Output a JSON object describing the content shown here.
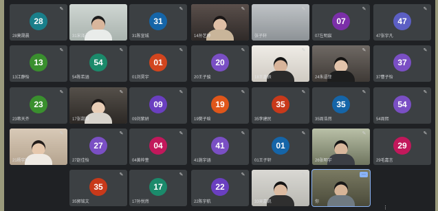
{
  "participants": [
    {
      "kind": "avatar",
      "number": "28",
      "color": "#1a7f8a",
      "name": "28莫晟晨"
    },
    {
      "kind": "video",
      "name": "31宋泽灵",
      "scene": "boy-light"
    },
    {
      "kind": "avatar",
      "number": "31",
      "color": "#1565a8",
      "name": "31陈宣城"
    },
    {
      "kind": "video",
      "name": "14孙艺婷",
      "scene": "girl-room"
    },
    {
      "kind": "video",
      "name": "张子轩",
      "scene": "empty-light"
    },
    {
      "kind": "avatar",
      "number": "07",
      "color": "#7b2fa8",
      "name": "07左明宸"
    },
    {
      "kind": "avatar",
      "number": "47",
      "color": "#5c5fc4",
      "name": "47张宇凡"
    },
    {
      "kind": "avatar",
      "number": "",
      "color": "#3c4043",
      "name": ""
    },
    {
      "kind": "avatar",
      "number": "",
      "color": "#3c4043",
      "name": ""
    },
    {
      "kind": "avatar",
      "number": "",
      "color": "#3c4043",
      "name": ""
    },
    {
      "kind": "avatar",
      "number": "",
      "color": "#3c4043",
      "name": ""
    },
    {
      "kind": "avatar",
      "number": "",
      "color": "#3c4043",
      "name": ""
    },
    {
      "kind": "avatar",
      "number": "",
      "color": "#3c4043",
      "name": ""
    },
    {
      "kind": "avatar",
      "number": "",
      "color": "#3c4043",
      "name": ""
    },
    {
      "kind": "avatar",
      "number": "13",
      "color": "#3a8f2e",
      "name": "13江静怡"
    },
    {
      "kind": "avatar",
      "number": "54",
      "color": "#1b8a6b",
      "name": "54陈若涵"
    },
    {
      "kind": "avatar",
      "number": "01",
      "color": "#d2451e",
      "name": "01刘昊宇"
    },
    {
      "kind": "avatar",
      "number": "20",
      "color": "#7a4fc4",
      "name": "20王子骏"
    },
    {
      "kind": "video",
      "name": "18王鑫辰",
      "scene": "boy-headset"
    },
    {
      "kind": "video",
      "name": "24朱语菲",
      "scene": "girl-dark"
    },
    {
      "kind": "avatar",
      "number": "37",
      "color": "#7a4fc4",
      "name": "37曹子怡"
    },
    {
      "kind": "avatar",
      "number": "23",
      "color": "#3a8f2e",
      "name": "23蒋天齐"
    },
    {
      "kind": "video",
      "name": "17张甜甜",
      "scene": "girl-lamp"
    },
    {
      "kind": "avatar",
      "number": "09",
      "color": "#6a3fc0",
      "name": "09刘紫妍"
    },
    {
      "kind": "avatar",
      "number": "19",
      "color": "#e0561a",
      "name": "19樊子晗"
    },
    {
      "kind": "avatar",
      "number": "35",
      "color": "#c8391a",
      "name": "35李建民"
    },
    {
      "kind": "avatar",
      "number": "35",
      "color": "#1565a8",
      "name": "35周浩然"
    },
    {
      "kind": "avatar",
      "number": "54",
      "color": "#7a4fc4",
      "name": "54周熙"
    },
    {
      "kind": "video",
      "name": "21杨宇婷",
      "scene": "girl-warm"
    },
    {
      "kind": "avatar",
      "number": "27",
      "color": "#7a4fc4",
      "name": "27赵佳怡"
    },
    {
      "kind": "avatar",
      "number": "04",
      "color": "#c2185b",
      "name": "04黄梓萱"
    },
    {
      "kind": "avatar",
      "number": "41",
      "color": "#7a4fc4",
      "name": "41施宇涵"
    },
    {
      "kind": "avatar",
      "number": "01",
      "color": "#1565a8",
      "name": "01王子轩"
    },
    {
      "kind": "video",
      "name": "26张明宇",
      "scene": "boy-room"
    },
    {
      "kind": "avatar",
      "number": "29",
      "color": "#c2185b",
      "name": "29毛嘉言"
    },
    {
      "kind": "avatar",
      "number": "35",
      "color": "#c8391a",
      "name": "35郭铭文"
    },
    {
      "kind": "avatar",
      "number": "17",
      "color": "#1b8a6b",
      "name": "17孙悦然"
    },
    {
      "kind": "avatar",
      "number": "22",
      "color": "#6a3fc0",
      "name": "22陈宇航"
    },
    {
      "kind": "video",
      "name": "33吴嘉凯",
      "scene": "boy-wall"
    },
    {
      "kind": "video",
      "name": "你",
      "scene": "boy-shelf",
      "active": true
    }
  ],
  "mic_icon": "mic-off-icon"
}
